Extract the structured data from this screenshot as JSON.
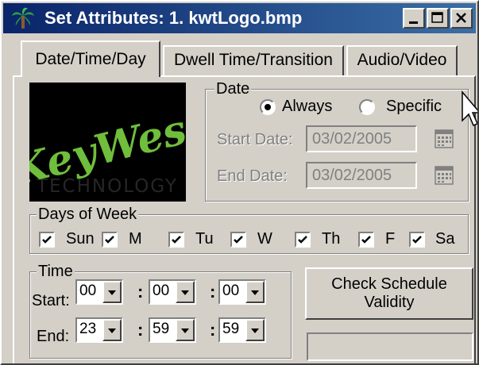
{
  "window": {
    "title": "Set Attributes: 1. kwtLogo.bmp"
  },
  "tabs": [
    {
      "label": "Date/Time/Day"
    },
    {
      "label": "Dwell Time/Transition"
    },
    {
      "label": "Audio/Video"
    }
  ],
  "logo": {
    "text": "KeyWest",
    "subtext": "TECHNOLOGY"
  },
  "date": {
    "legend": "Date",
    "always_label": "Always",
    "specific_label": "Specific",
    "selected": "Always",
    "start_label": "Start Date:",
    "start_value": "03/02/2005",
    "end_label": "End Date:",
    "end_value": "03/02/2005"
  },
  "days": {
    "legend": "Days of Week",
    "items": [
      {
        "label": "Sun",
        "checked": true
      },
      {
        "label": "M",
        "checked": true
      },
      {
        "label": "Tu",
        "checked": true
      },
      {
        "label": "W",
        "checked": true
      },
      {
        "label": "Th",
        "checked": true
      },
      {
        "label": "F",
        "checked": true
      },
      {
        "label": "Sa",
        "checked": true
      }
    ]
  },
  "time": {
    "legend": "Time",
    "start_label": "Start:",
    "end_label": "End:",
    "start": {
      "hour": "00",
      "minute": "00",
      "second": "00"
    },
    "end": {
      "hour": "23",
      "minute": "59",
      "second": "59"
    },
    "separator": ":"
  },
  "check_button": {
    "line1": "Check Schedule",
    "line2": "Validity"
  },
  "colors": {
    "titlebar": "#0a246a",
    "face": "#d4d0c8",
    "logo_green": "#6fbe3c"
  }
}
